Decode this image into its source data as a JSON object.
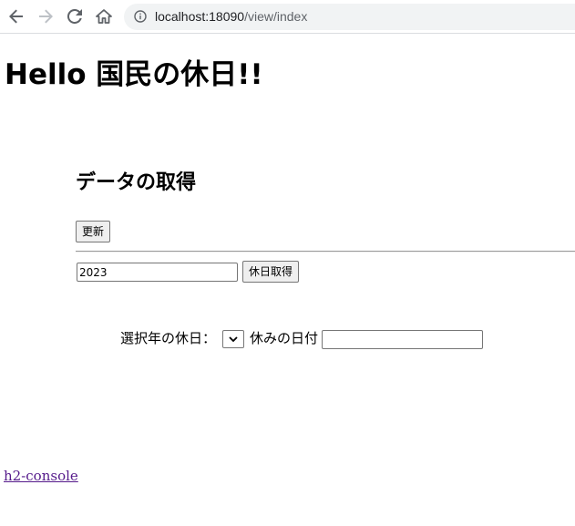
{
  "browser": {
    "url_host": "localhost:18090",
    "url_path": "/view/index",
    "icons": [
      "back-arrow-icon",
      "forward-arrow-icon",
      "reload-icon",
      "home-icon",
      "info-icon"
    ]
  },
  "page": {
    "title": "Hello 国民の休日!!",
    "section_heading": "データの取得",
    "refresh_button": "更新",
    "year_value": "2023",
    "get_holidays_button": "休日取得",
    "year_holiday_label": "選択年の休日：",
    "holiday_date_label": "休みの日付",
    "holiday_date_value": "",
    "h2_console_link": "h2-console"
  },
  "colors": {
    "link_visited": "#551a8b",
    "omnibox_bg": "#f1f3f4",
    "forward_disabled": "#bdc1c6",
    "icon": "#5f6368"
  }
}
